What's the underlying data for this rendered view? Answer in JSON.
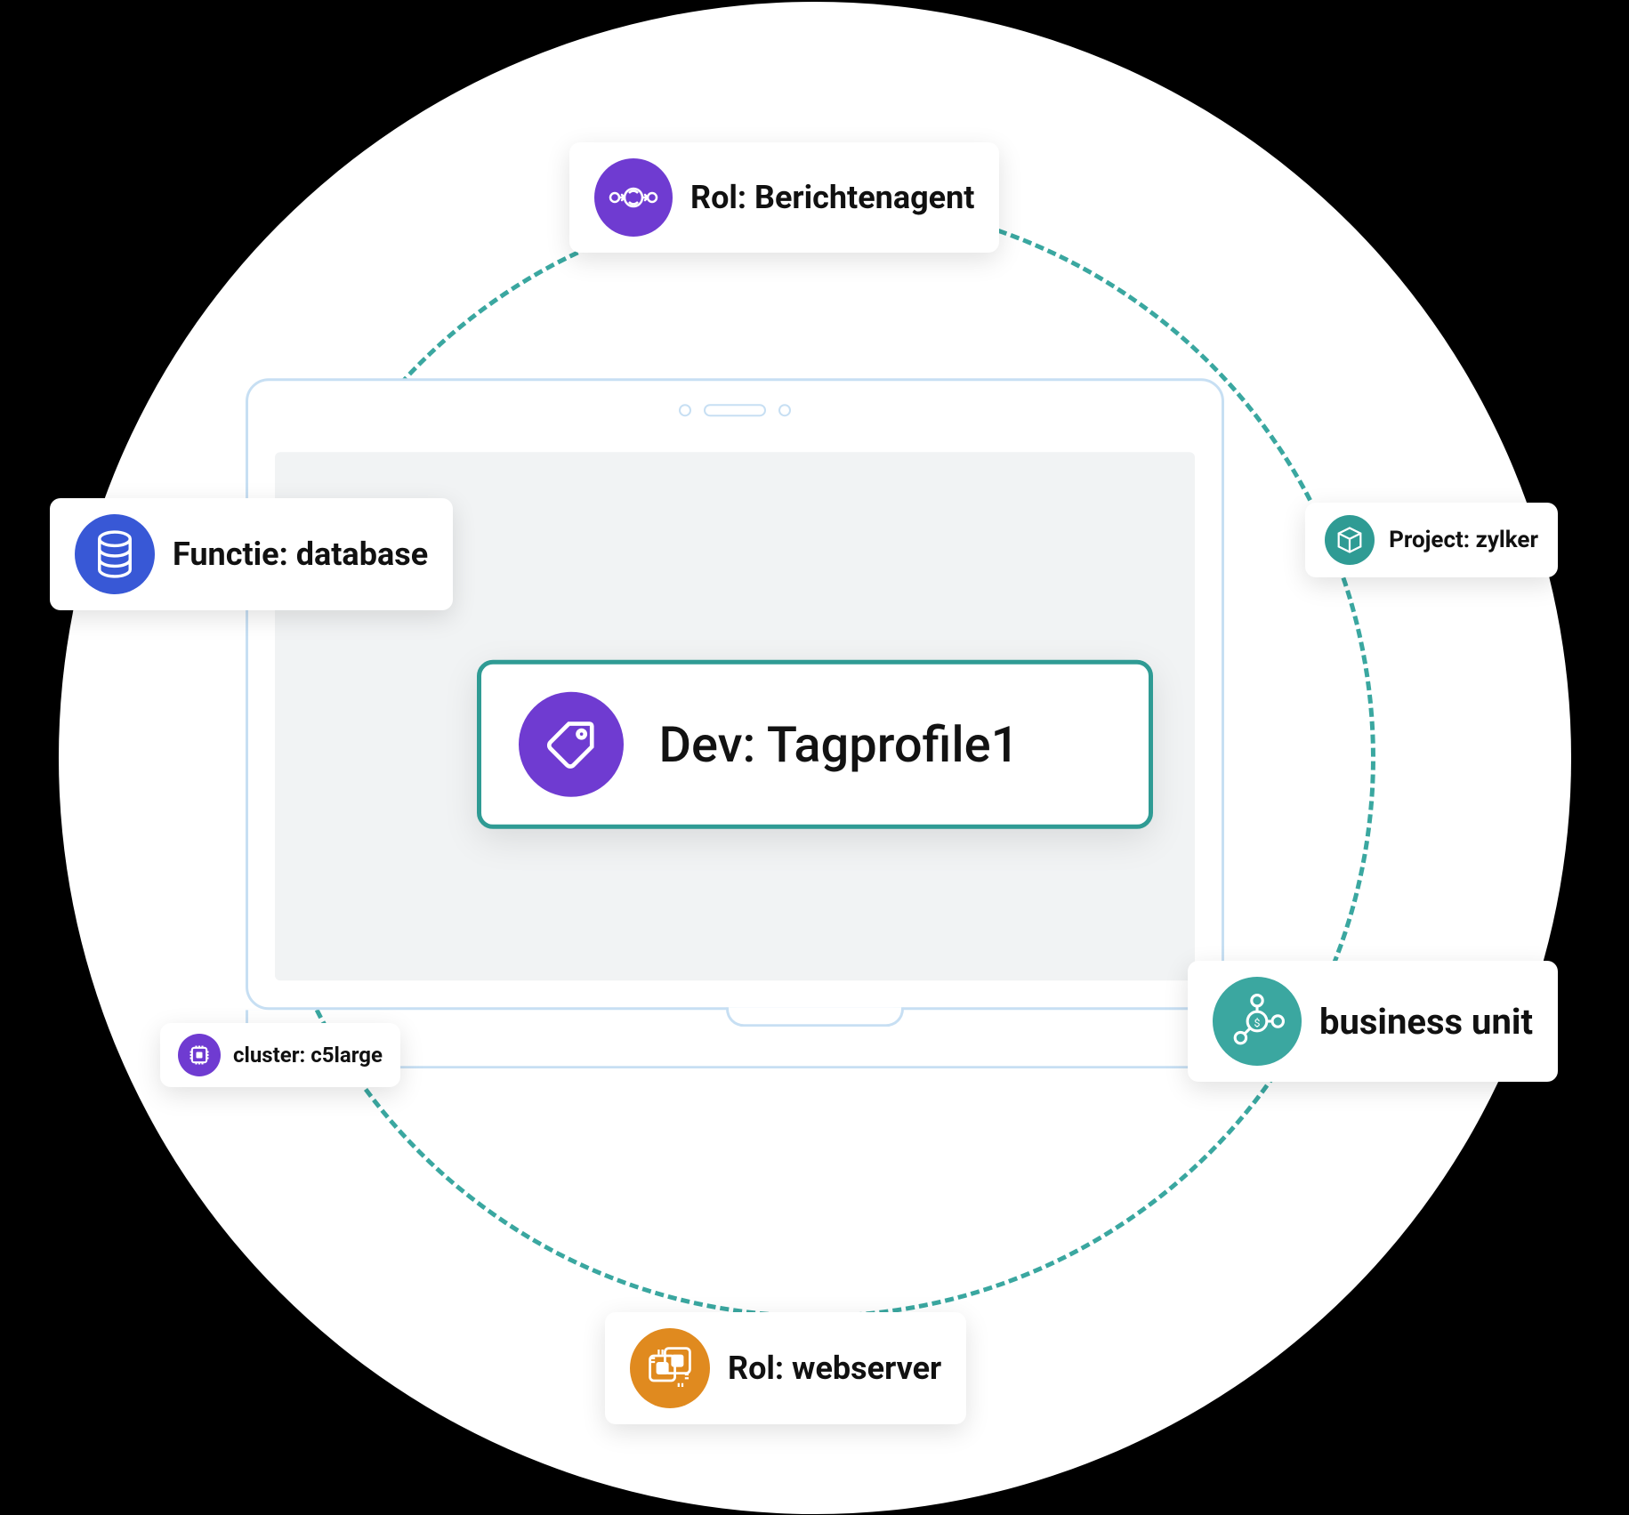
{
  "center": {
    "label": "Dev: Tagprofile1",
    "icon": "tag-icon",
    "color": "#6f3bd1",
    "border": "#2f9b94"
  },
  "cards": {
    "role_top": {
      "label": "Rol: Berichtenagent",
      "icon": "flow-icon",
      "color": "#6f3bd1"
    },
    "functie": {
      "label": "Functie: database",
      "icon": "database-icon",
      "color": "#3858d6"
    },
    "project": {
      "label": "Project: zylker",
      "icon": "cube-icon",
      "color": "#2f9b94"
    },
    "business": {
      "label": "business unit",
      "icon": "network-icon",
      "color": "#3ba7a0"
    },
    "cluster": {
      "label": "cluster: c5large",
      "icon": "chip-icon",
      "color": "#6f3bd1"
    },
    "role_bottom": {
      "label": "Rol: webserver",
      "icon": "servers-icon",
      "color": "#e08a1f"
    }
  },
  "decor": {
    "dashed_circle_color": "#3aa7a0",
    "background_circle": "#ffffff"
  }
}
